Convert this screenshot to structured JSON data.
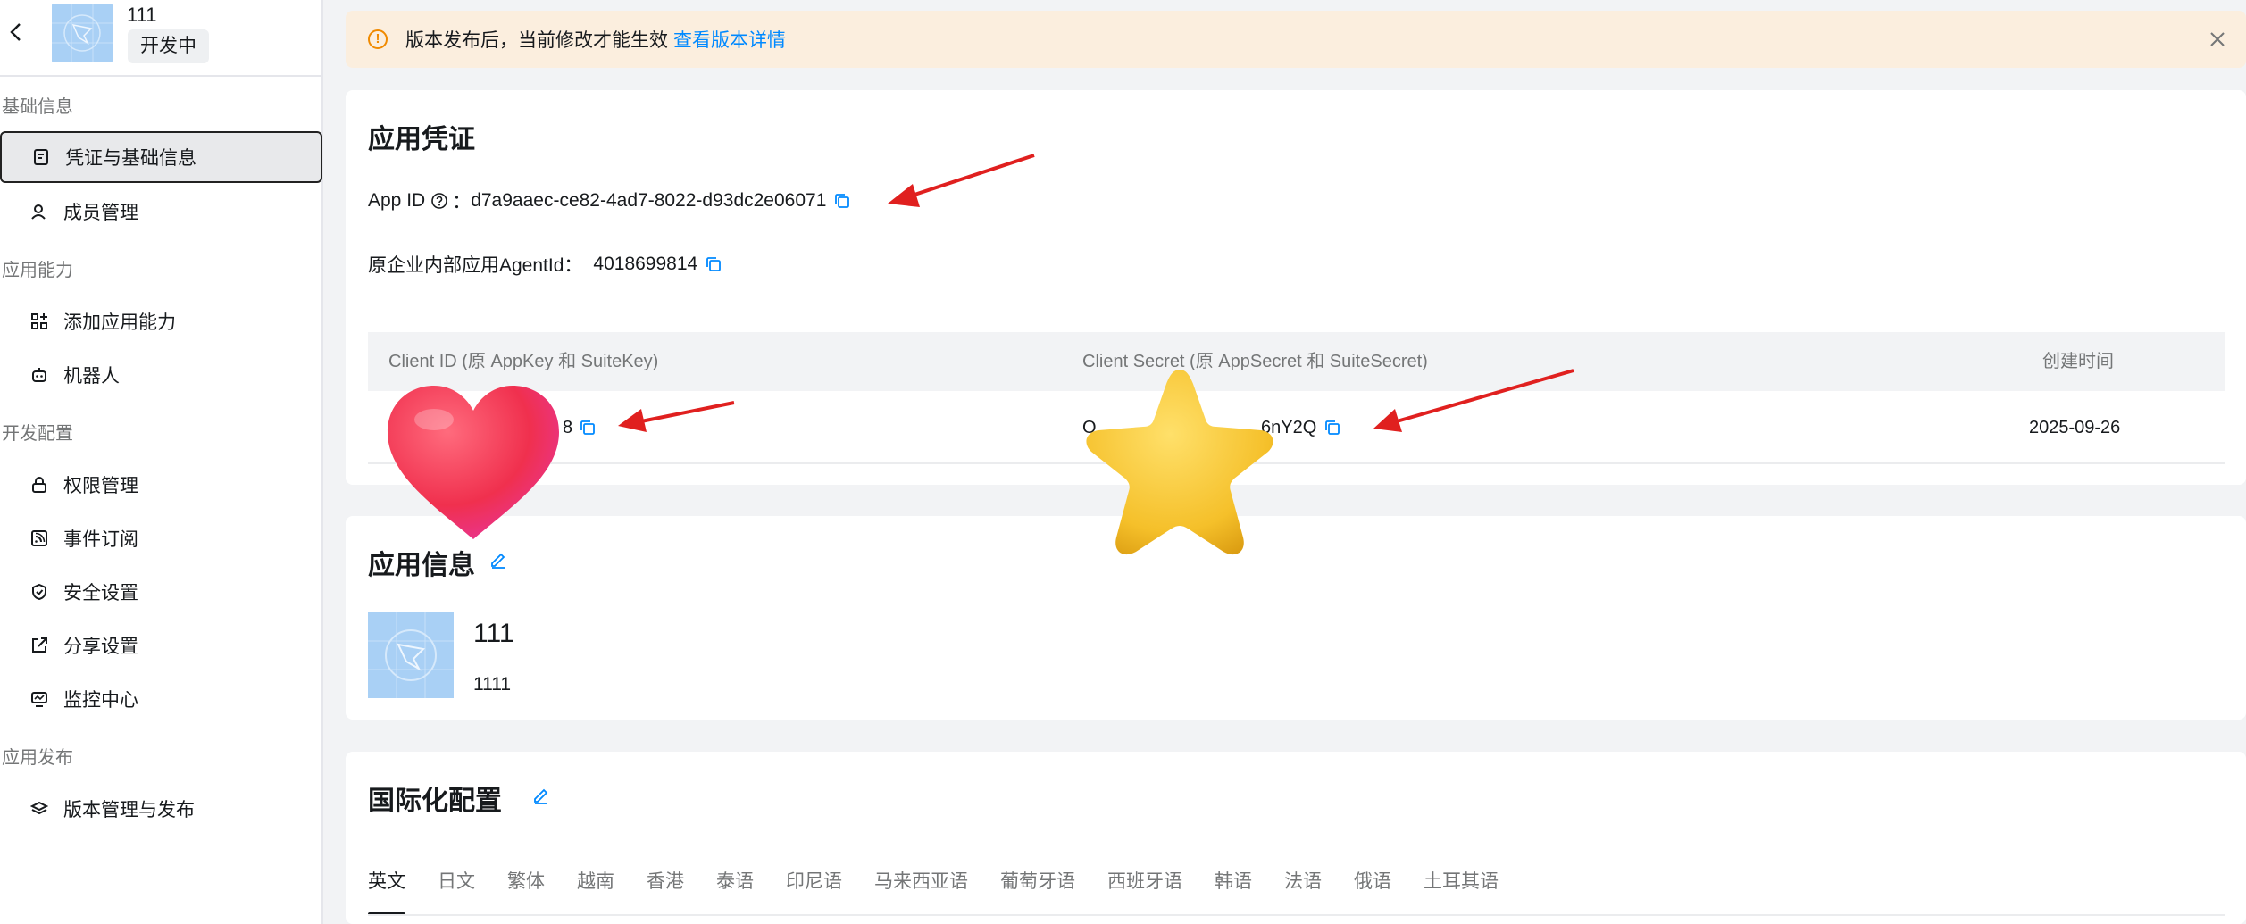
{
  "sidebar": {
    "app_name": "111",
    "status": "开发中",
    "groups": [
      {
        "label": "基础信息"
      },
      {
        "label": "应用能力"
      },
      {
        "label": "开发配置"
      },
      {
        "label": "应用发布"
      }
    ],
    "items": [
      {
        "label": "凭证与基础信息",
        "icon": "document-id-icon"
      },
      {
        "label": "成员管理",
        "icon": "user-icon"
      },
      {
        "label": "添加应用能力",
        "icon": "grid-add-icon"
      },
      {
        "label": "机器人",
        "icon": "robot-icon"
      },
      {
        "label": "权限管理",
        "icon": "lock-icon"
      },
      {
        "label": "事件订阅",
        "icon": "rss-icon"
      },
      {
        "label": "安全设置",
        "icon": "shield-icon"
      },
      {
        "label": "分享设置",
        "icon": "share-icon"
      },
      {
        "label": "监控中心",
        "icon": "monitor-icon"
      },
      {
        "label": "版本管理与发布",
        "icon": "layers-icon"
      }
    ]
  },
  "banner": {
    "message": "版本发布后，当前修改才能生效",
    "link": "查看版本详情",
    "accent": "#f08a00",
    "background": "#fbeede"
  },
  "credentials": {
    "title": "应用凭证",
    "app_id_label": "App ID",
    "app_id_sep": "：",
    "app_id_value": "d7a9aaec-ce82-4ad7-8022-d93dc2e06071",
    "agent_label": "原企业内部应用AgentId：",
    "agent_value": "4018699814",
    "table": {
      "headers": [
        "Client ID (原 AppKey 和 SuiteKey)",
        "Client Secret (原 AppSecret 和 SuiteSecret)",
        "创建时间"
      ],
      "row": {
        "client_id": "8",
        "client_secret_start": "O",
        "client_secret_end": "6nY2Q",
        "created": "2025-09-26"
      }
    }
  },
  "app_info": {
    "title": "应用信息",
    "name": "111",
    "description": "1111"
  },
  "i18n": {
    "title": "国际化配置",
    "tabs": [
      "英文",
      "日文",
      "繁体",
      "越南",
      "香港",
      "泰语",
      "印尼语",
      "马来西亚语",
      "葡萄牙语",
      "西班牙语",
      "韩语",
      "法语",
      "俄语",
      "土耳其语"
    ],
    "active_tab": "英文"
  },
  "colors": {
    "link": "#0089ff",
    "arrow": "#e0201f",
    "heart": "#f0306a",
    "star": "#f5c02a"
  }
}
